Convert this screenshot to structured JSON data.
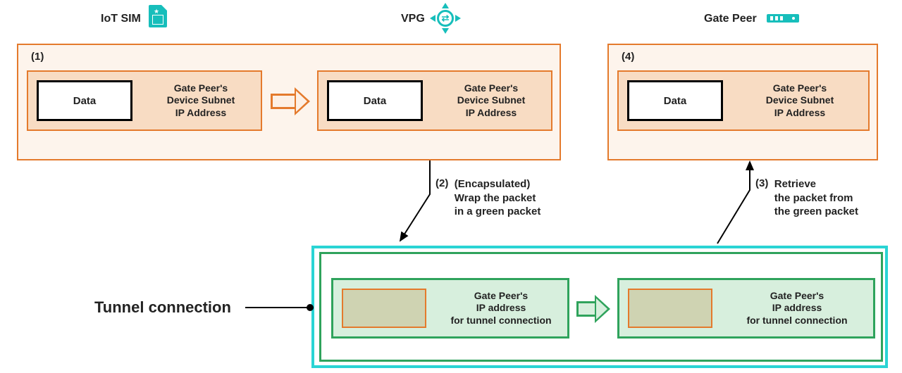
{
  "header": {
    "iot_sim": "IoT SIM",
    "vpg": "VPG",
    "gate_peer": "Gate Peer"
  },
  "packet": {
    "data_label": "Data",
    "orange_text": "Gate Peer's\nDevice Subnet\nIP Address",
    "green_text": "Gate Peer's\nIP address\nfor tunnel connection"
  },
  "steps": {
    "s1": "(1)",
    "s2_num": "(2)",
    "s2_text": "(Encapsulated)\nWrap the packet\nin a green packet",
    "s3_num": "(3)",
    "s3_text": "Retrieve\nthe packet from\nthe green packet",
    "s4": "(4)"
  },
  "tunnel_label": "Tunnel connection",
  "colors": {
    "orange": "#e47a2c",
    "orange_fill": "#f8dcc3",
    "green": "#2fa35c",
    "green_fill": "#d7efdd",
    "teal": "#2ad4d4"
  }
}
